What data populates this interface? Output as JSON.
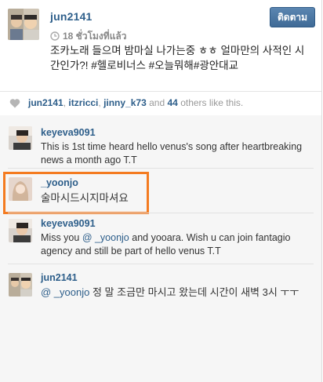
{
  "post": {
    "author": "jun2141",
    "time": "18 ชั่วโมงที่แล้ว",
    "caption": "조카노래 들으며 밤마실 나가는중 ㅎㅎ 얼마만의 사적인 시간인가?! #헬로비너스 #오늘뭐해#광안대교",
    "follow_label": "ติดตาม"
  },
  "likes": {
    "users": [
      "jun2141",
      "itzricci",
      "jinny_k73"
    ],
    "joiner": "and",
    "count": "44",
    "suffix": "others like this."
  },
  "comments": [
    {
      "user": "keyeva9091",
      "text": "This is 1st time heard hello venus's song after heartbreaking news a month ago T.T"
    },
    {
      "user": "_yoonjo",
      "text": "술마시드시지마셔요"
    },
    {
      "user": "keyeva9091",
      "text_before": "Miss you",
      "mention": "@ _yoonjo",
      "text_after": "and yooara. Wish u can join fantagio agency and still be part of hello venus T.T"
    },
    {
      "user": "jun2141",
      "mention": "@ _yoonjo",
      "text_after": "정 말 조금만 마시고 왔는데 시간이 새벽 3시 ㅜㅜ"
    }
  ],
  "colors": {
    "link": "#2d5e8a",
    "button": "#4a76a3",
    "highlight": "#f47b20"
  }
}
